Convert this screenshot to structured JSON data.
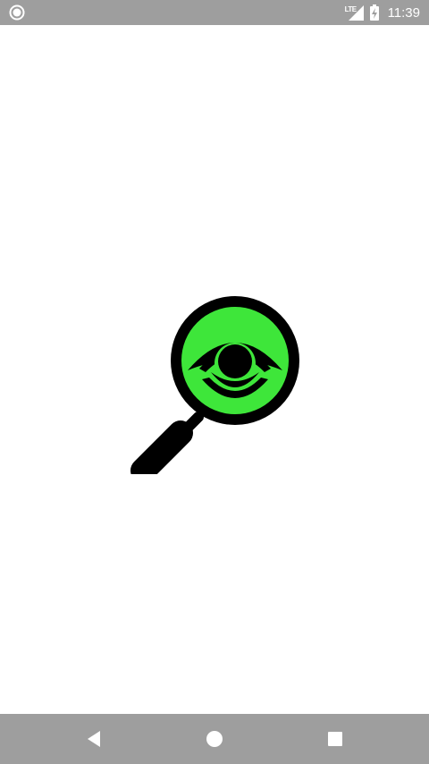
{
  "status_bar": {
    "network_label": "LTE",
    "time": "11:39",
    "left_icon": "circle-notification-icon",
    "signal_icon": "cell-signal-icon",
    "battery_icon": "battery-charging-icon"
  },
  "main": {
    "logo_icon": "magnifier-eye-icon",
    "colors": {
      "lens_fill": "#3ee63a",
      "outline": "#000000"
    }
  },
  "nav_bar": {
    "back_icon": "back-triangle-icon",
    "home_icon": "home-circle-icon",
    "recents_icon": "recents-square-icon"
  },
  "colors": {
    "system_bars": "#9e9e9e",
    "background": "#ffffff"
  }
}
